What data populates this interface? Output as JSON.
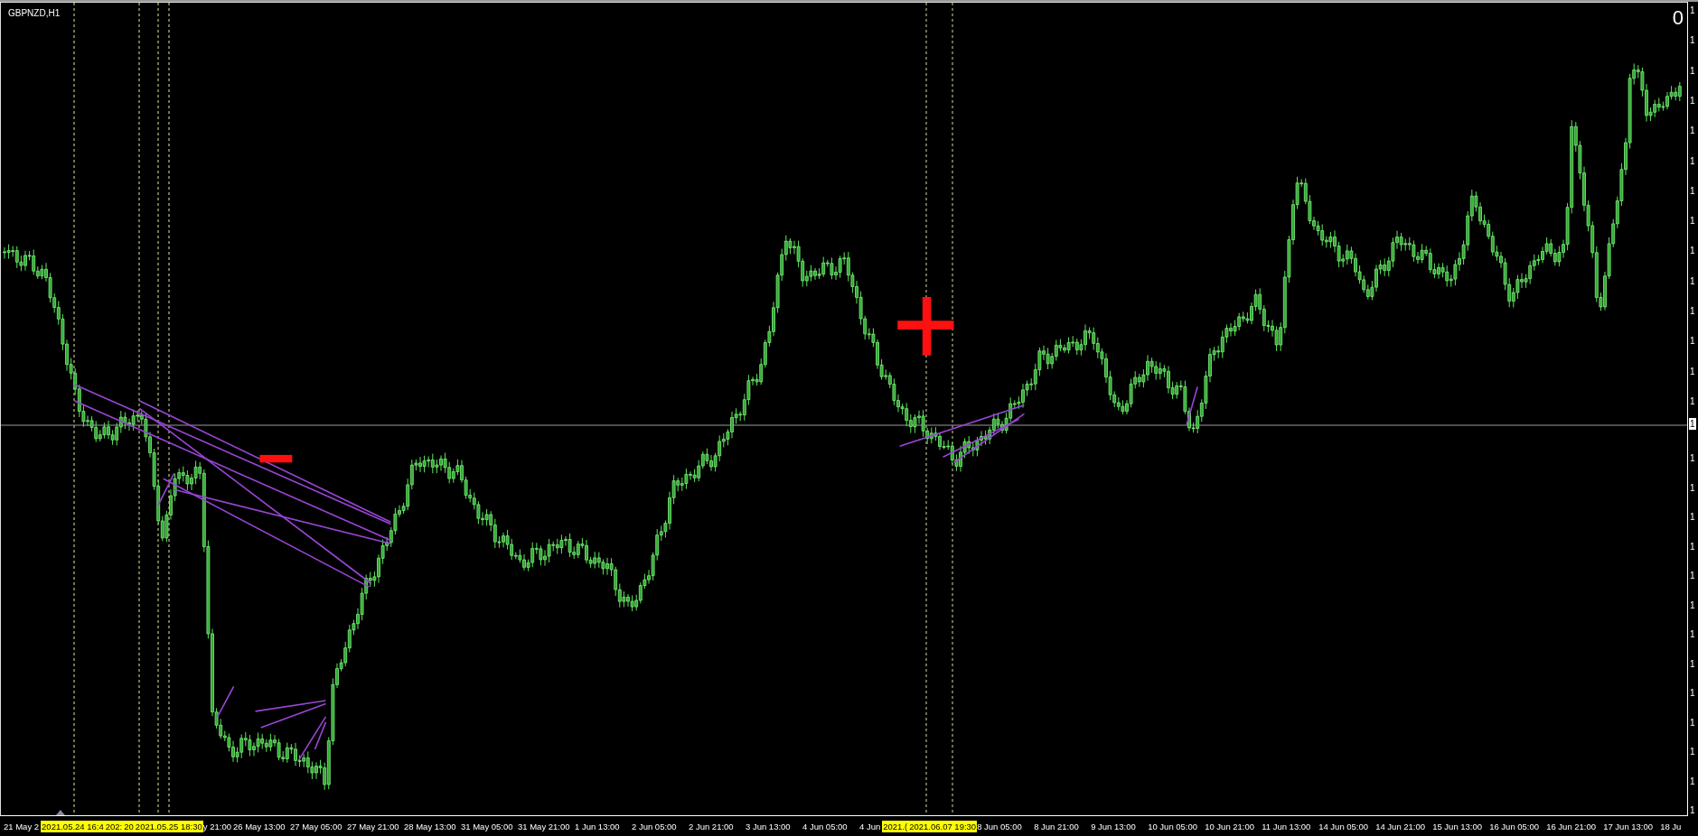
{
  "chart": {
    "symbol": "GBPNZD,H1",
    "corner_text": "0",
    "current_price_label": "1"
  },
  "price_axis": {
    "labels": [
      "1",
      "1",
      "1",
      "1",
      "1",
      "1",
      "1",
      "1",
      "1",
      "1",
      "1",
      "1",
      "1",
      "1",
      "1",
      "1",
      "1",
      "1",
      "1",
      "1",
      "1",
      "1",
      "1",
      "1",
      "1",
      "1",
      "1"
    ]
  },
  "time_axis": {
    "labels": [
      {
        "kind": "partial",
        "text": "21 May 2"
      },
      {
        "kind": "marker",
        "text": "2021.05.24 16:4"
      },
      {
        "kind": "marker",
        "text": "202:"
      },
      {
        "kind": "marker",
        "text": "20"
      },
      {
        "kind": "marker",
        "text": "2021.05.25 18:30"
      },
      {
        "kind": "partial",
        "text": "y 21:00"
      },
      {
        "kind": "tick",
        "text": "26 May 13:00"
      },
      {
        "kind": "tick",
        "text": "27 May 05:00"
      },
      {
        "kind": "tick",
        "text": "27 May 21:00"
      },
      {
        "kind": "tick",
        "text": "28 May 13:00"
      },
      {
        "kind": "tick",
        "text": "31 May 05:00"
      },
      {
        "kind": "tick",
        "text": "31 May 21:00"
      },
      {
        "kind": "tick",
        "text": "1 Jun 13:00"
      },
      {
        "kind": "tick",
        "text": "2 Jun 05:00"
      },
      {
        "kind": "tick",
        "text": "2 Jun 21:00"
      },
      {
        "kind": "tick",
        "text": "3 Jun 13:00"
      },
      {
        "kind": "tick",
        "text": "4 Jun 05:00"
      },
      {
        "kind": "partial",
        "text": "4 Jun"
      },
      {
        "kind": "marker",
        "text": "2021.("
      },
      {
        "kind": "marker",
        "text": "2021.06.07 19:30"
      },
      {
        "kind": "tick",
        "text": "8 Jun 05:00"
      },
      {
        "kind": "tick",
        "text": "8 Jun 21:00"
      },
      {
        "kind": "tick",
        "text": "9 Jun 13:00"
      },
      {
        "kind": "tick",
        "text": "10 Jun 05:00"
      },
      {
        "kind": "tick",
        "text": "10 Jun 21:00"
      },
      {
        "kind": "tick",
        "text": "11 Jun 13:00"
      },
      {
        "kind": "tick",
        "text": "14 Jun 05:00"
      },
      {
        "kind": "tick",
        "text": "14 Jun 21:00"
      },
      {
        "kind": "tick",
        "text": "15 Jun 13:00"
      },
      {
        "kind": "tick",
        "text": "16 Jun 05:00"
      },
      {
        "kind": "tick",
        "text": "16 Jun 21:00"
      },
      {
        "kind": "tick",
        "text": "17 Jun 13:00"
      },
      {
        "kind": "partial",
        "text": "18 Ju"
      }
    ]
  }
}
